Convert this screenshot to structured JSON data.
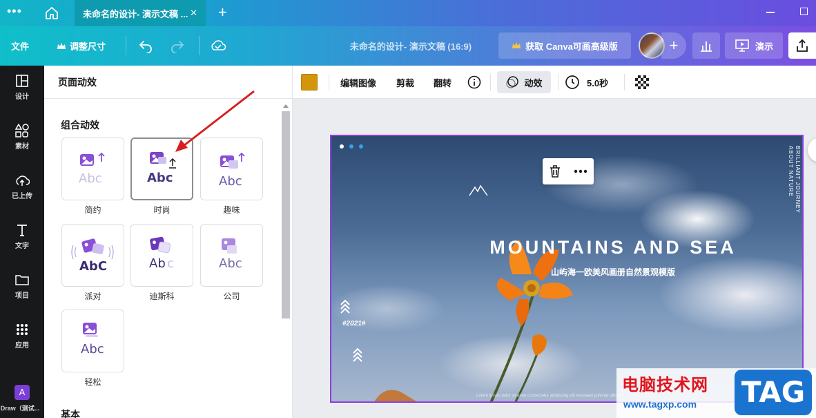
{
  "titlebar": {
    "tab_title": "未命名的设计- 演示文稿 ...",
    "tab_close": "✕",
    "new_tab": "+"
  },
  "toolbar": {
    "file": "文件",
    "resize": "调整尺寸",
    "doc_title": "未命名的设计- 演示文稿 (16:9)",
    "upgrade": "获取 Canva可画高级版",
    "add_member": "+",
    "present": "演示"
  },
  "rail": {
    "items": [
      {
        "label": "设计",
        "icon": "layout-icon"
      },
      {
        "label": "素材",
        "icon": "shapes-icon"
      },
      {
        "label": "已上传",
        "icon": "upload-icon"
      },
      {
        "label": "文字",
        "icon": "text-icon"
      },
      {
        "label": "项目",
        "icon": "folder-icon"
      },
      {
        "label": "应用",
        "icon": "apps-icon"
      }
    ],
    "app_label": "Draw（测试..."
  },
  "panel": {
    "header": "页面动效",
    "section_combo": "组合动效",
    "section_basic": "基本",
    "cards": [
      {
        "label": "简约",
        "selected": false
      },
      {
        "label": "时尚",
        "selected": true
      },
      {
        "label": "趣味",
        "selected": false
      },
      {
        "label": "派对",
        "selected": false
      },
      {
        "label": "迪斯科",
        "selected": false
      },
      {
        "label": "公司",
        "selected": false
      },
      {
        "label": "轻松",
        "selected": false
      }
    ],
    "card_text": "Abc"
  },
  "context_bar": {
    "swatch_color": "#d3950c",
    "edit_image": "编辑图像",
    "crop": "剪裁",
    "flip": "翻转",
    "animate": "动效",
    "duration": "5.0秒"
  },
  "design": {
    "side_text": "BRILLIANT JOURNEY ABOUT NATURE",
    "title": "MOUNTAINS AND SEA",
    "subtitle": "山屿海一欧美风画册自然景观模版",
    "year": "#2021#",
    "footer": "Lorem ipsum dolor sit amet consectetur adipiscing elit massaed pulvinar ultricies"
  },
  "watermark": {
    "title": "电脑技术网",
    "url": "www.tagxp.com",
    "tag": "TAG"
  },
  "colors": {
    "accent_purple": "#8b3fe0",
    "arrow_red": "#d6201e"
  }
}
